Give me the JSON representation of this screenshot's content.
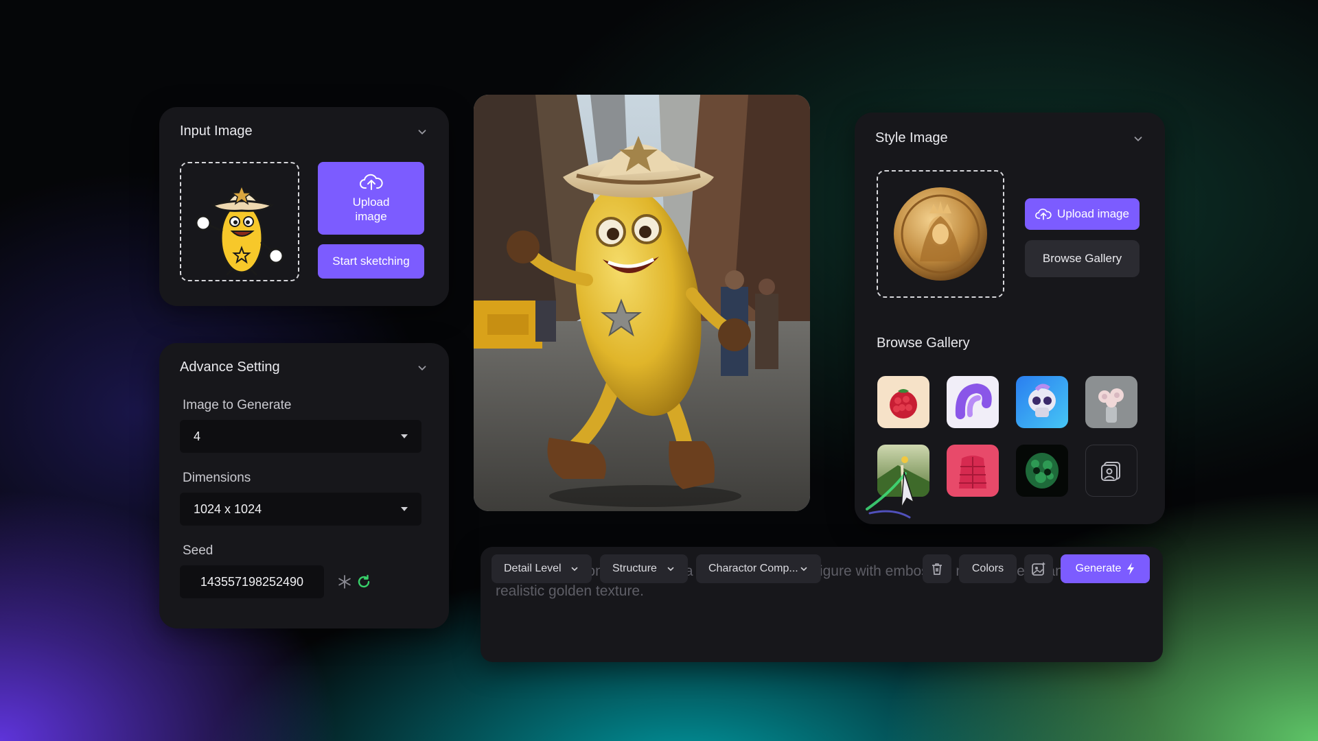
{
  "input_panel": {
    "title": "Input Image",
    "upload_label": "Upload image",
    "sketch_label": "Start sketching"
  },
  "advanced_panel": {
    "title": "Advance Setting",
    "image_count_label": "Image to Generate",
    "image_count_value": "4",
    "dimensions_label": "Dimensions",
    "dimensions_value": "1024 x 1024",
    "seed_label": "Seed",
    "seed_value": "143557198252490"
  },
  "style_panel": {
    "title": "Style Image",
    "upload_label": "Upload image",
    "browse_label": "Browse Gallery",
    "gallery_title": "Browse Gallery"
  },
  "prompt": {
    "text": "Turn this cartoon mascot into a gold coin-style 3D figure with embossed metallic detail and realistic golden texture.",
    "chips": [
      "Detail Level",
      "Structure",
      "Charactor Comp..."
    ],
    "colors_label": "Colors",
    "generate_label": "Generate"
  },
  "colors": {
    "accent": "#7c5cff",
    "panel": "#17171b",
    "field": "#0e0e11"
  }
}
